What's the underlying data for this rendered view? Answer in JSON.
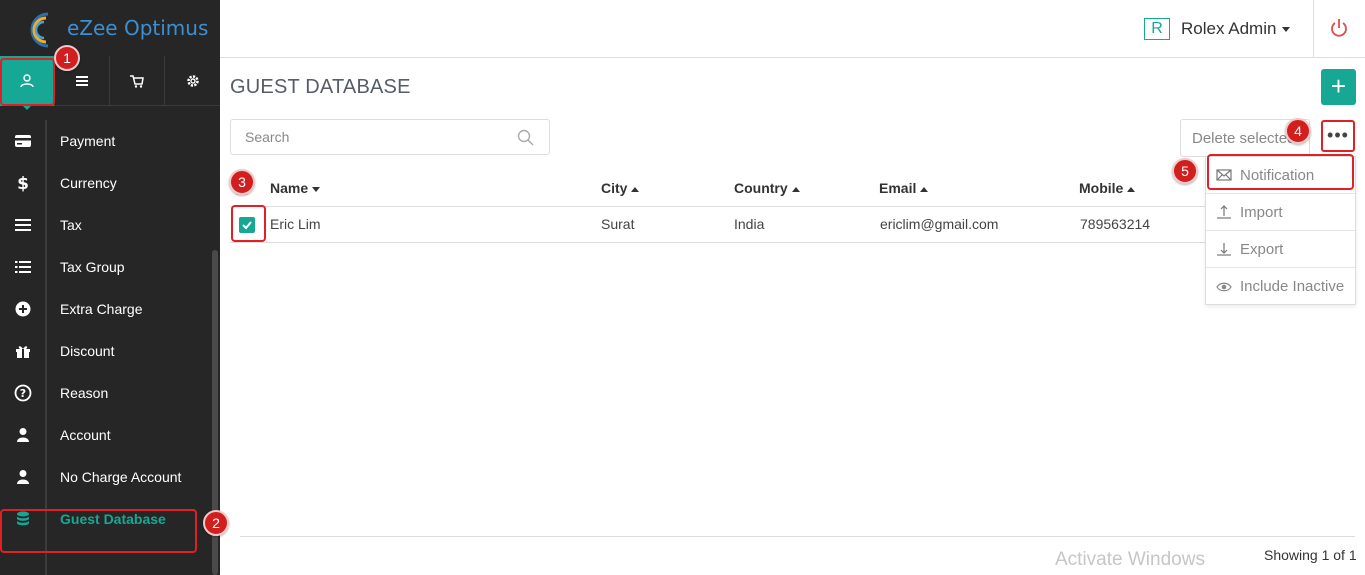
{
  "app": {
    "title": "eZee Optimus"
  },
  "sidebar": {
    "tabs": [
      {
        "icon": "user-icon",
        "active": true
      },
      {
        "icon": "menu-icon",
        "active": false
      },
      {
        "icon": "cart-icon",
        "active": false
      },
      {
        "icon": "gear-icon",
        "active": false
      }
    ],
    "items": [
      {
        "label": "Payment",
        "icon": "credit-card-icon"
      },
      {
        "label": "Currency",
        "icon": "dollar-icon"
      },
      {
        "label": "Tax",
        "icon": "bars-icon"
      },
      {
        "label": "Tax Group",
        "icon": "list-icon"
      },
      {
        "label": "Extra Charge",
        "icon": "plus-circle-icon"
      },
      {
        "label": "Discount",
        "icon": "gift-icon"
      },
      {
        "label": "Reason",
        "icon": "question-circle-icon"
      },
      {
        "label": "Account",
        "icon": "user-icon"
      },
      {
        "label": "No Charge Account",
        "icon": "user-icon"
      },
      {
        "label": "Guest Database",
        "icon": "database-icon",
        "active": true
      }
    ]
  },
  "header": {
    "user_initial": "R",
    "user_name": "Rolex Admin"
  },
  "main": {
    "title": "GUEST DATABASE",
    "add_label": "+",
    "search_placeholder": "Search",
    "delete_label": "Delete selected",
    "more_label": "•••",
    "columns": [
      {
        "label": "Name",
        "sort": "desc"
      },
      {
        "label": "City",
        "sort": "asc"
      },
      {
        "label": "Country",
        "sort": "asc"
      },
      {
        "label": "Email",
        "sort": "asc"
      },
      {
        "label": "Mobile",
        "sort": "asc"
      }
    ],
    "rows": [
      {
        "checked": true,
        "name": "Eric Lim",
        "city": "Surat",
        "country": "India",
        "email": "ericlim@gmail.com",
        "mobile": "789563214"
      }
    ],
    "dropdown": [
      {
        "label": "Notification",
        "icon": "envelope-icon"
      },
      {
        "label": "Import",
        "icon": "upload-icon"
      },
      {
        "label": "Export",
        "icon": "download-icon"
      },
      {
        "label": "Include Inactive",
        "icon": "eye-icon"
      }
    ],
    "footer_showing": "Showing 1 of 1",
    "watermark": "Activate Windows"
  },
  "annotations": [
    "1",
    "2",
    "3",
    "4",
    "5"
  ],
  "colors": {
    "accent": "#17a795",
    "sidebar_bg": "#262626",
    "annotation": "#e01f26"
  }
}
